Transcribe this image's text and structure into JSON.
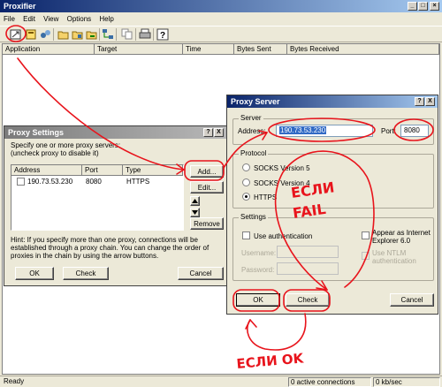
{
  "main_window": {
    "title": "Proxifier",
    "menu": [
      "File",
      "Edit",
      "View",
      "Options",
      "Help"
    ],
    "columns": [
      "Application",
      "Target",
      "Time",
      "Bytes Sent",
      "Bytes Received"
    ],
    "status": {
      "ready": "Ready",
      "connections": "0 active connections",
      "speed": "0 kb/sec"
    }
  },
  "proxy_settings": {
    "title": "Proxy Settings",
    "help": "?",
    "close": "X",
    "intro": "Specify one or more proxy servers:\n(uncheck proxy to disable it)",
    "columns": [
      "Address",
      "Port",
      "Type"
    ],
    "rows": [
      {
        "address": "190.73.53.230",
        "port": "8080",
        "type": "HTTPS",
        "checked": false
      }
    ],
    "buttons": {
      "add": "Add...",
      "edit": "Edit...",
      "remove": "Remove",
      "ok": "OK",
      "check": "Check",
      "cancel": "Cancel"
    },
    "hint": "Hint: If you specify more than one proxy, connections will be established through a proxy chain. You can change the order of proxies in the chain by using the arrow buttons."
  },
  "proxy_server": {
    "title": "Proxy Server",
    "help": "?",
    "close": "X",
    "server_group": "Server",
    "address_label": "Address:",
    "address_value": "190.73.53.230",
    "port_label": "Port:",
    "port_value": "8080",
    "protocol_group": "Protocol",
    "protocols": [
      "SOCKS Version 5",
      "SOCKS Version 4",
      "HTTPS"
    ],
    "selected_protocol": "HTTPS",
    "settings_group": "Settings",
    "use_auth": "Use authentication",
    "username_label": "Username:",
    "password_label": "Password:",
    "appear_ie": "Appear as Internet Explorer 6.0",
    "use_ntlm": "Use NTLM authentication",
    "buttons": {
      "ok": "OK",
      "check": "Check",
      "cancel": "Cancel"
    }
  },
  "annotations": {
    "fail_line1": "ЕСЛИ",
    "fail_line2": "FAIL",
    "ok_text": "ЕСЛИ OK",
    "color": "#e8141c"
  }
}
